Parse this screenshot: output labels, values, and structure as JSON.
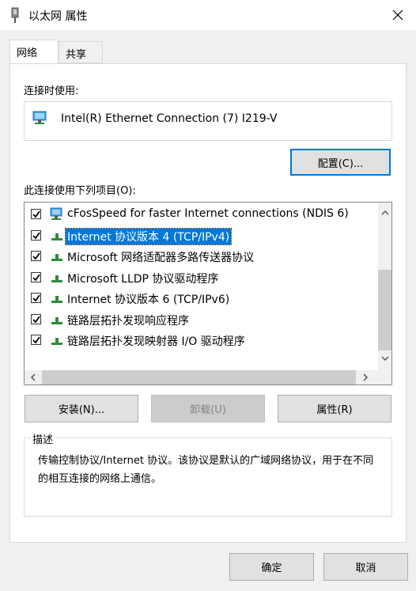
{
  "window": {
    "title": "以太网 属性",
    "close_icon": "close-icon"
  },
  "tabs": [
    {
      "label": "网络",
      "active": true
    },
    {
      "label": "共享",
      "active": false
    }
  ],
  "connect_using": {
    "label": "连接时使用:",
    "adapter_name": "Intel(R) Ethernet Connection (7) I219-V",
    "configure_button": "配置(C)..."
  },
  "items_section": {
    "label": "此连接使用下列项目(O):",
    "items": [
      {
        "text": "cFosSpeed for faster Internet connections (NDIS 6)",
        "checked": true,
        "selected": false,
        "icon": "network-client-icon"
      },
      {
        "text": "Internet 协议版本 4 (TCP/IPv4)",
        "checked": true,
        "selected": true,
        "icon": "protocol-icon"
      },
      {
        "text": "Microsoft 网络适配器多路传送器协议",
        "checked": true,
        "selected": false,
        "icon": "protocol-icon"
      },
      {
        "text": "Microsoft LLDP 协议驱动程序",
        "checked": true,
        "selected": false,
        "icon": "protocol-icon"
      },
      {
        "text": "Internet 协议版本 6 (TCP/IPv6)",
        "checked": true,
        "selected": false,
        "icon": "protocol-icon"
      },
      {
        "text": "链路层拓扑发现响应程序",
        "checked": true,
        "selected": false,
        "icon": "protocol-icon"
      },
      {
        "text": "链路层拓扑发现映射器 I/O 驱动程序",
        "checked": true,
        "selected": false,
        "icon": "protocol-icon"
      }
    ]
  },
  "actions": {
    "install": "安装(N)...",
    "uninstall": "卸载(U)",
    "properties": "属性(R)"
  },
  "description": {
    "title": "描述",
    "text": "传输控制协议/Internet 协议。该协议是默认的广域网络协议，用于在不同的相互连接的网络上通信。"
  },
  "footer": {
    "ok": "确定",
    "cancel": "取消"
  },
  "colors": {
    "accent": "#0078d7",
    "protocol_green": "#2e8b3d"
  }
}
